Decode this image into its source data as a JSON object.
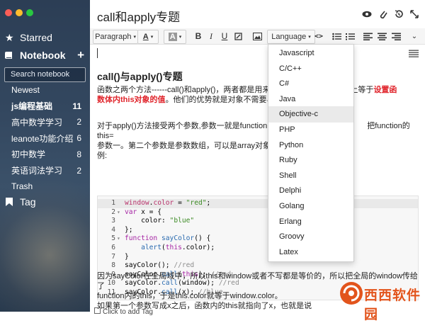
{
  "sidebar": {
    "starred": "Starred",
    "notebook": "Notebook",
    "add": "+",
    "search_placeholder": "Search notebook",
    "items": [
      {
        "label": "Newest",
        "count": ""
      },
      {
        "label": "js编程基础",
        "count": "11"
      },
      {
        "label": "高中数学学习",
        "count": "2"
      },
      {
        "label": "leanote功能介绍",
        "count": "6"
      },
      {
        "label": "初中数学",
        "count": "8"
      },
      {
        "label": "英语词法学习",
        "count": "2"
      },
      {
        "label": "Trash",
        "count": ""
      }
    ],
    "tag": "Tag"
  },
  "note": {
    "title": "call和apply专题",
    "heading": "call()与apply()专题",
    "p1a": "函数之两个方法------call()和apply()，两者都是用来在",
    "p1b": "实际上等于",
    "p1c": "设置函",
    "p2a": "数体内this对象的值",
    "p2b": "。他们的优势就是对象不需要与",
    "p3a": "对于apply()方法接受两个参数,参数一就是function的",
    "p3b": "把function的this=",
    "p4": "参数一。第二个参数是参数数组，可以是array对象，",
    "p5": "例:",
    "p6": "因为sayColor在全局域中，所以this和window或者不写都是等价的，所以把全局的window传给了",
    "p7": "function内的this，于是this.color就等于window.color。",
    "p8": "如果第一个参数写成x之后，函数内的this就指向了x，也就是说"
  },
  "toolbar": {
    "paragraph": "Paragraph",
    "language": "Language"
  },
  "code": [
    {
      "n": "1",
      "fold": "",
      "parts": [
        [
          "t",
          "window"
        ],
        [
          "",
          "."
        ],
        [
          "t",
          "color"
        ],
        [
          "",
          " = "
        ],
        [
          "s",
          "\"red\""
        ],
        [
          "",
          ";"
        ]
      ]
    },
    {
      "n": "2",
      "fold": "▾",
      "parts": [
        [
          "k",
          "var"
        ],
        [
          "",
          " x = {"
        ]
      ]
    },
    {
      "n": "3",
      "fold": "",
      "parts": [
        [
          "",
          "    color: "
        ],
        [
          "s",
          "\"blue\""
        ]
      ]
    },
    {
      "n": "4",
      "fold": "",
      "parts": [
        [
          "",
          "};"
        ]
      ]
    },
    {
      "n": "5",
      "fold": "▾",
      "parts": [
        [
          "k",
          "function"
        ],
        [
          "",
          " "
        ],
        [
          "f",
          "sayColor"
        ],
        [
          "",
          "() {"
        ]
      ]
    },
    {
      "n": "6",
      "fold": "",
      "parts": [
        [
          "",
          "    "
        ],
        [
          "f",
          "alert"
        ],
        [
          "",
          "("
        ],
        [
          "k",
          "this"
        ],
        [
          "",
          ".color);"
        ]
      ]
    },
    {
      "n": "7",
      "fold": "",
      "parts": [
        [
          "",
          "}"
        ]
      ]
    },
    {
      "n": "8",
      "fold": "",
      "parts": [
        [
          "",
          "sayColor(); "
        ],
        [
          "c",
          "//red"
        ]
      ]
    },
    {
      "n": "9",
      "fold": "",
      "parts": [
        [
          "",
          "sayColor."
        ],
        [
          "f",
          "call"
        ],
        [
          "",
          "("
        ],
        [
          "k",
          "this"
        ],
        [
          "",
          "); "
        ],
        [
          "c",
          "//red"
        ]
      ]
    },
    {
      "n": "10",
      "fold": "",
      "parts": [
        [
          "",
          "sayColor."
        ],
        [
          "f",
          "call"
        ],
        [
          "",
          "(window); "
        ],
        [
          "c",
          "//red"
        ]
      ]
    },
    {
      "n": "11",
      "fold": "",
      "parts": [
        [
          "",
          "sayColor."
        ],
        [
          "f",
          "call"
        ],
        [
          "",
          "(x); "
        ],
        [
          "c",
          "//blue"
        ]
      ]
    }
  ],
  "languages": [
    "Javascript",
    "C/C++",
    "C#",
    "Java",
    "Objective-c",
    "PHP",
    "Python",
    "Ruby",
    "Shell",
    "Delphi",
    "Golang",
    "Erlang",
    "Groovy",
    "Latex"
  ],
  "selected_language": "Objective-c",
  "footer_tag": "Click to add Tag",
  "watermark": "西西软件园",
  "colors": {
    "accent_red": "#e0242b",
    "sidebar": "#2f435a",
    "watermark": "#e2541c"
  }
}
